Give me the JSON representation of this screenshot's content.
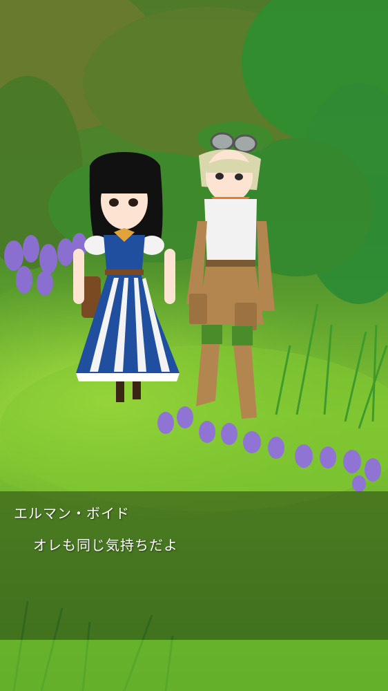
{
  "dialogue": {
    "speaker": "エルマン・ボイド",
    "line": "オレも同じ気持ちだよ"
  },
  "characters": [
    {
      "role": "girl-in-blue-striped-dress"
    },
    {
      "role": "boy-with-green-cap-and-goggles"
    }
  ],
  "colors": {
    "grass": "#7cc52e",
    "foliage": "#2f8a2a",
    "flowers": "#8a6fd0",
    "dialogue_bg": "rgba(40,70,20,0.55)",
    "text": "#ffffff"
  }
}
